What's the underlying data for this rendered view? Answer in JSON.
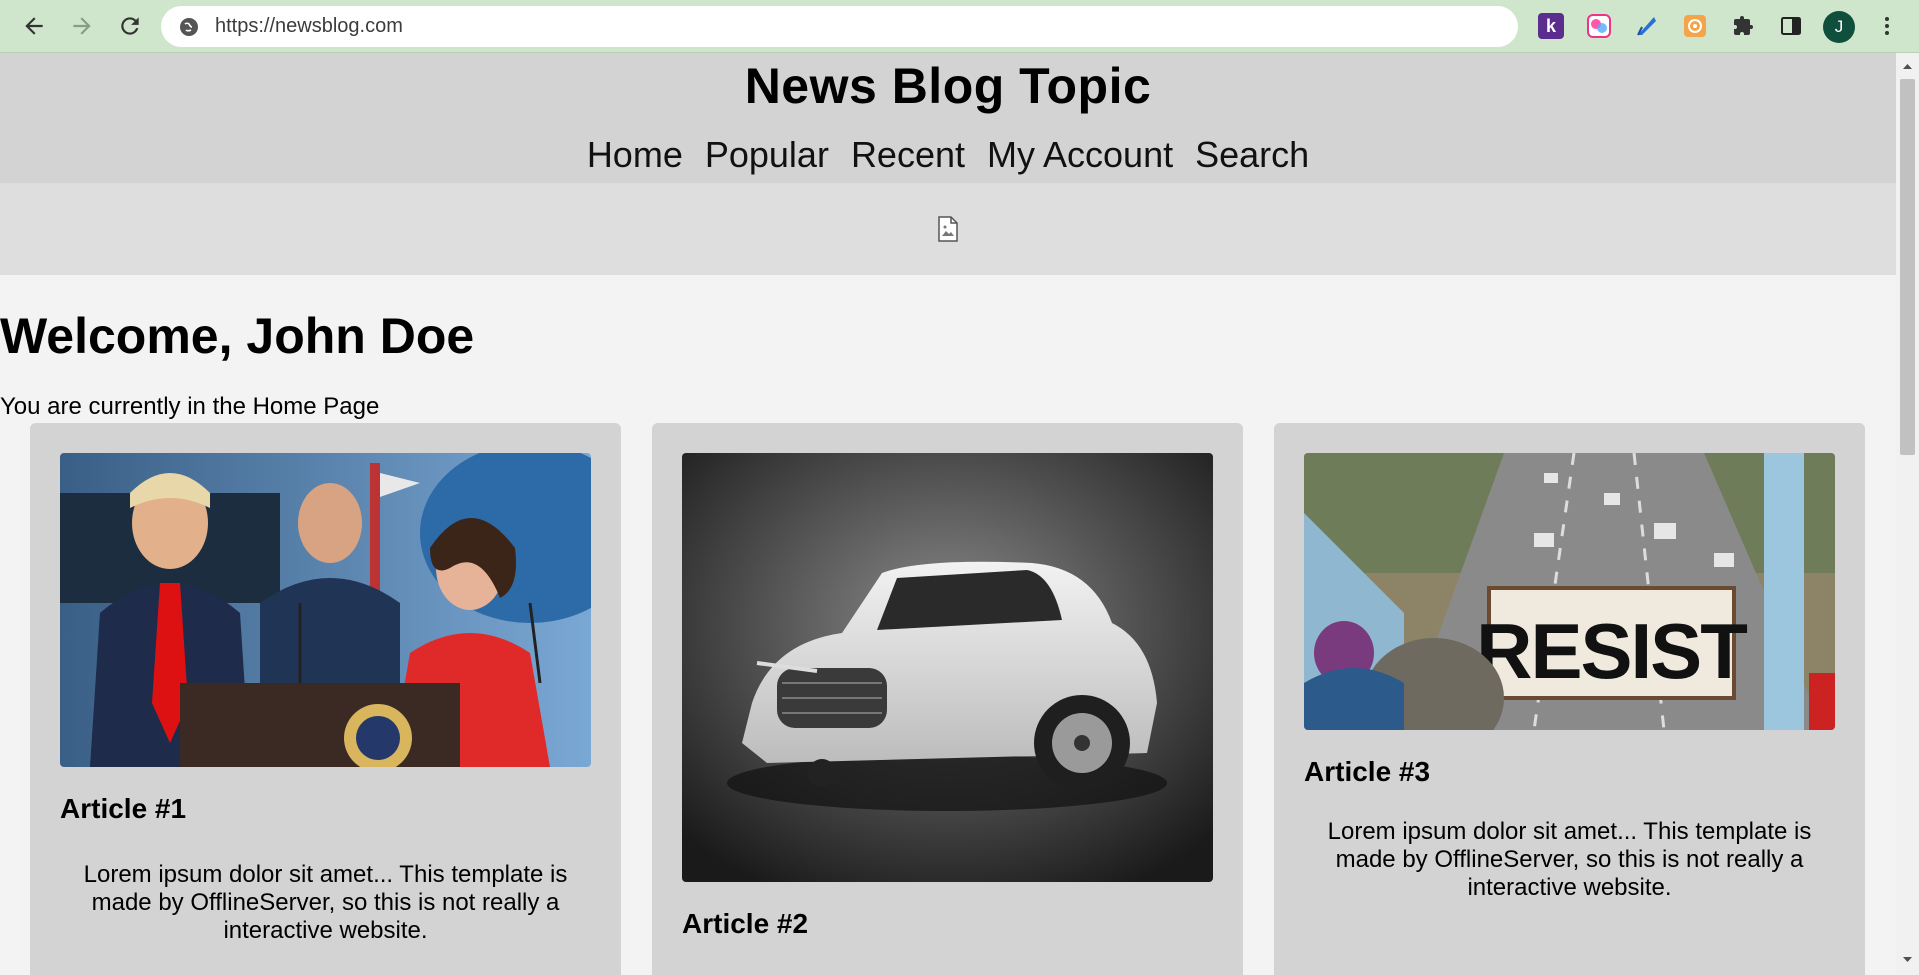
{
  "browser": {
    "url": "https://newsblog.com",
    "profile_initial": "J",
    "extension_k_label": "k"
  },
  "site": {
    "title": "News Blog Topic",
    "nav": [
      "Home",
      "Popular",
      "Recent",
      "My Account",
      "Search"
    ]
  },
  "main": {
    "welcome": "Welcome, John Doe",
    "subtitle": "You are currently in the Home Page"
  },
  "articles": [
    {
      "title": "Article #1",
      "text": "Lorem ipsum dolor sit amet... This template is made by OfflineServer, so this is not really a interactive website."
    },
    {
      "title": "Article #2",
      "text": ""
    },
    {
      "title": "Article #3",
      "text": "Lorem ipsum dolor sit amet... This template is made by OfflineServer, so this is not really a interactive website."
    }
  ]
}
